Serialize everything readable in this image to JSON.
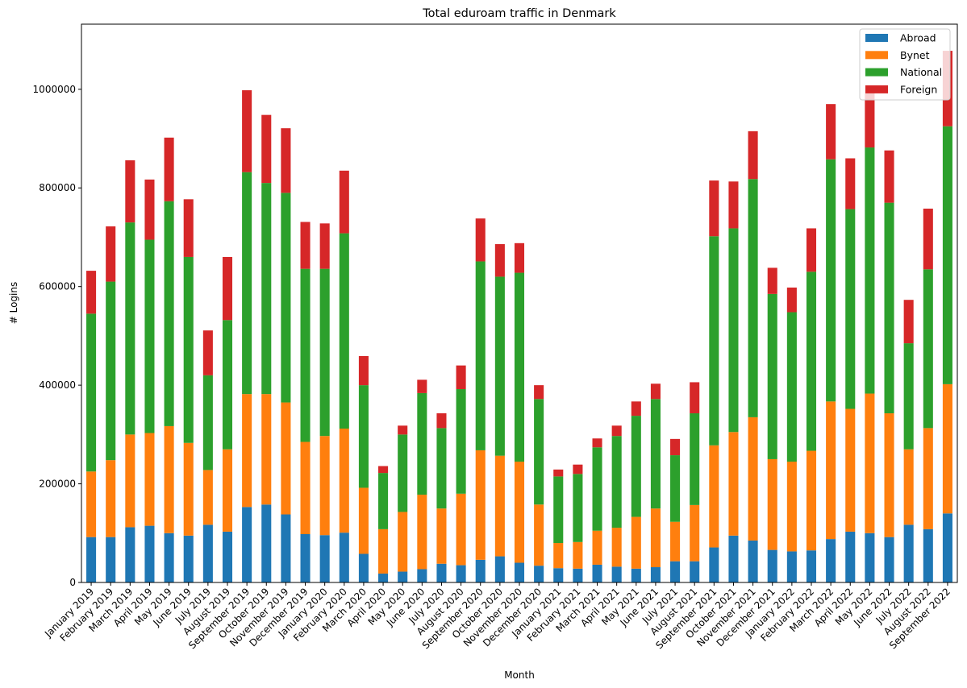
{
  "chart_data": {
    "type": "bar",
    "stacked": true,
    "title": "Total eduroam traffic in Denmark",
    "xlabel": "Month",
    "ylabel": "# Logins",
    "ylim": [
      0,
      1132000
    ],
    "yticks": [
      0,
      200000,
      400000,
      600000,
      800000,
      1000000
    ],
    "grid": false,
    "legend_position": "top-right",
    "categories": [
      "January 2019",
      "February 2019",
      "March 2019",
      "April 2019",
      "May 2019",
      "June 2019",
      "July 2019",
      "August 2019",
      "September 2019",
      "October 2019",
      "November 2019",
      "December 2019",
      "January 2020",
      "February 2020",
      "March 2020",
      "April 2020",
      "May 2020",
      "June 2020",
      "July 2020",
      "August 2020",
      "September 2020",
      "October 2020",
      "November 2020",
      "December 2020",
      "January 2021",
      "February 2021",
      "March 2021",
      "April 2021",
      "May 2021",
      "June 2021",
      "July 2021",
      "August 2021",
      "September 2021",
      "October 2021",
      "November 2021",
      "December 2021",
      "January 2022",
      "February 2022",
      "March 2022",
      "April 2022",
      "May 2022",
      "June 2022",
      "July 2022",
      "August 2022",
      "September 2022"
    ],
    "series": [
      {
        "name": "Abroad",
        "color": "#1f77b4",
        "values": [
          92000,
          92000,
          112000,
          115000,
          100000,
          95000,
          117000,
          103000,
          153000,
          158000,
          138000,
          98000,
          96000,
          101000,
          58000,
          18000,
          22000,
          27000,
          38000,
          35000,
          46000,
          53000,
          40000,
          34000,
          29000,
          28000,
          36000,
          32000,
          28000,
          31000,
          43000,
          43000,
          71000,
          95000,
          85000,
          66000,
          63000,
          65000,
          88000,
          103000,
          100000,
          92000,
          117000,
          108000,
          140000
        ]
      },
      {
        "name": "Bynet",
        "color": "#ff7f0e",
        "values": [
          133000,
          156000,
          188000,
          188000,
          217000,
          188000,
          111000,
          167000,
          229000,
          224000,
          227000,
          187000,
          201000,
          211000,
          134000,
          90000,
          121000,
          151000,
          112000,
          145000,
          222000,
          204000,
          205000,
          124000,
          51000,
          54000,
          69000,
          79000,
          105000,
          119000,
          80000,
          114000,
          207000,
          210000,
          250000,
          184000,
          182000,
          202000,
          279000,
          249000,
          283000,
          251000,
          153000,
          205000,
          262000
        ]
      },
      {
        "name": "National",
        "color": "#2ca02c",
        "values": [
          320000,
          362000,
          430000,
          392000,
          456000,
          377000,
          192000,
          262000,
          450000,
          428000,
          425000,
          351000,
          339000,
          396000,
          208000,
          114000,
          157000,
          206000,
          163000,
          212000,
          383000,
          363000,
          383000,
          214000,
          135000,
          138000,
          169000,
          186000,
          205000,
          222000,
          135000,
          186000,
          424000,
          413000,
          483000,
          335000,
          303000,
          363000,
          491000,
          405000,
          499000,
          427000,
          215000,
          322000,
          523000
        ]
      },
      {
        "name": "Foreign",
        "color": "#d62728",
        "values": [
          87000,
          112000,
          126000,
          122000,
          129000,
          117000,
          91000,
          128000,
          166000,
          138000,
          131000,
          95000,
          92000,
          127000,
          59000,
          14000,
          18000,
          27000,
          30000,
          48000,
          87000,
          66000,
          60000,
          28000,
          14000,
          19000,
          18000,
          21000,
          29000,
          31000,
          33000,
          63000,
          113000,
          95000,
          97000,
          53000,
          50000,
          88000,
          112000,
          103000,
          110000,
          106000,
          88000,
          123000,
          153000
        ]
      }
    ]
  }
}
